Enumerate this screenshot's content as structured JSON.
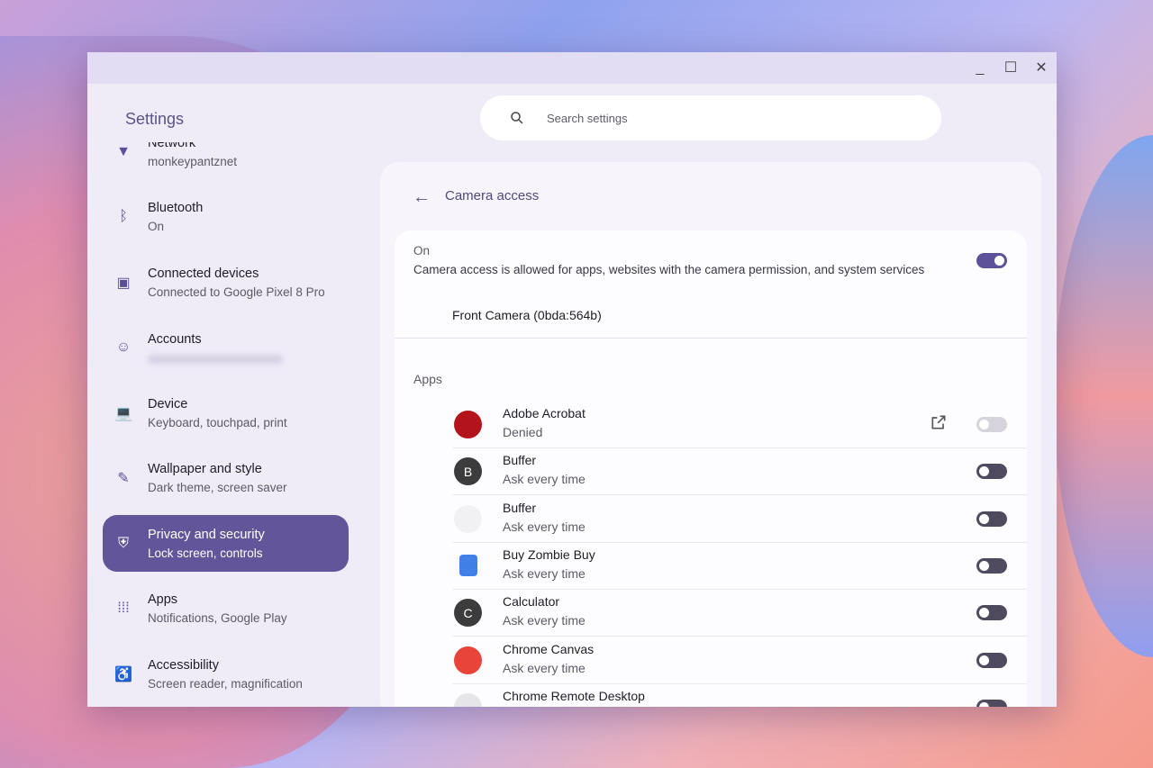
{
  "window": {
    "title": "Settings",
    "controls": [
      "minimize",
      "maximize",
      "close"
    ]
  },
  "search": {
    "placeholder": "Search settings"
  },
  "sidebar": {
    "items": [
      {
        "title": "Network",
        "subtitle": "monkeypantznet",
        "icon": "wifi-icon"
      },
      {
        "title": "Bluetooth",
        "subtitle": "On",
        "icon": "bluetooth-icon"
      },
      {
        "title": "Connected devices",
        "subtitle": "Connected to Google Pixel 8 Pro",
        "icon": "devices-icon"
      },
      {
        "title": "Accounts",
        "subtitle": "",
        "icon": "account-icon"
      },
      {
        "title": "Device",
        "subtitle": "Keyboard, touchpad, print",
        "icon": "laptop-icon"
      },
      {
        "title": "Wallpaper and style",
        "subtitle": "Dark theme, screen saver",
        "icon": "palette-icon"
      },
      {
        "title": "Privacy and security",
        "subtitle": "Lock screen, controls",
        "icon": "shield-icon",
        "selected": true
      },
      {
        "title": "Apps",
        "subtitle": "Notifications, Google Play",
        "icon": "apps-grid-icon"
      },
      {
        "title": "Accessibility",
        "subtitle": "Screen reader, magnification",
        "icon": "accessibility-icon"
      }
    ]
  },
  "main": {
    "title": "Camera access",
    "toggle": {
      "label": "On",
      "description": "Camera access is allowed for apps, websites with the camera permission, and system services",
      "on": true
    },
    "camera": "Front Camera (0bda:564b)",
    "apps_label": "Apps",
    "apps": [
      {
        "name": "Adobe Acrobat",
        "status": "Denied",
        "letter": "",
        "color": "#b3131b",
        "state": "disabled"
      },
      {
        "name": "Buffer",
        "status": "Ask every time",
        "letter": "B",
        "color": "#3c3c3c",
        "state": "off"
      },
      {
        "name": "Buffer",
        "status": "Ask every time",
        "letter": "",
        "color": "#f1f1f4",
        "state": "off"
      },
      {
        "name": "Buy Zombie Buy",
        "status": "Ask every time",
        "letter": "",
        "color": "#3f7fe6",
        "state": "off"
      },
      {
        "name": "Calculator",
        "status": "Ask every time",
        "letter": "C",
        "color": "#3c3c3c",
        "state": "off"
      },
      {
        "name": "Chrome Canvas",
        "status": "Ask every time",
        "letter": "",
        "color": "#e8443a",
        "state": "off"
      },
      {
        "name": "Chrome Remote Desktop",
        "status": "",
        "letter": "",
        "color": "#e6e6ea",
        "state": "off"
      }
    ]
  }
}
